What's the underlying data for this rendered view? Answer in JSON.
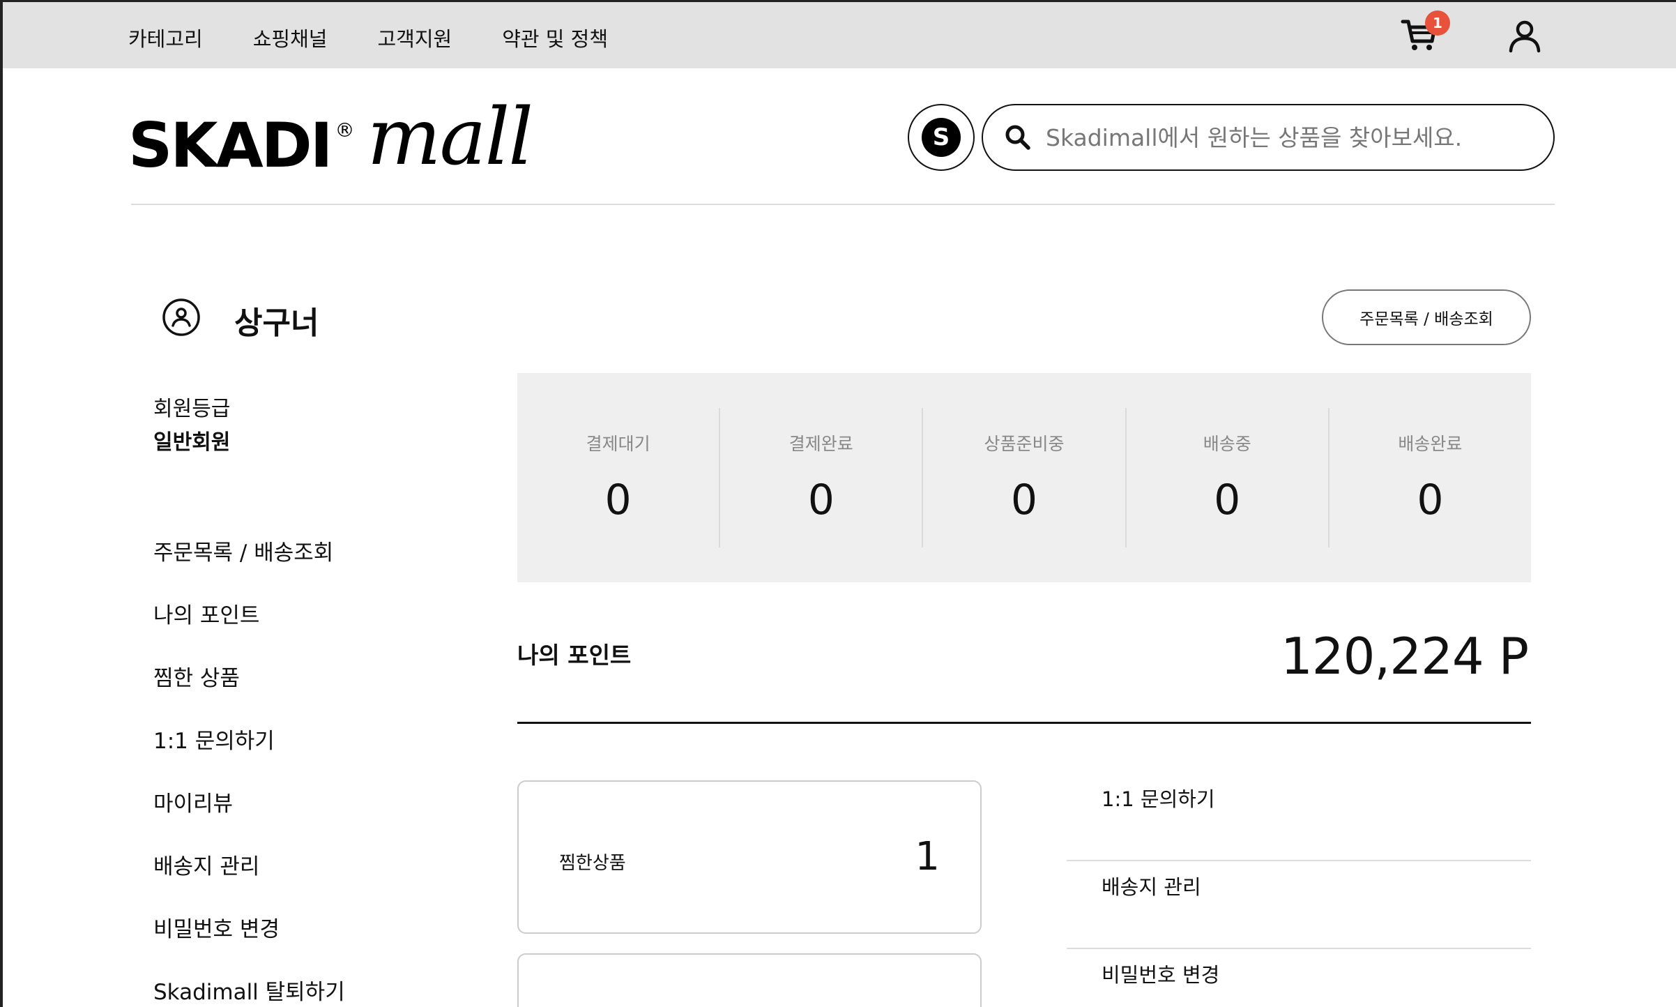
{
  "topnav": {
    "items": [
      "카테고리",
      "쇼핑채널",
      "고객지원",
      "약관 및 정책"
    ],
    "cart_count": "1"
  },
  "header": {
    "logo_brand": "SKADI",
    "logo_reg": "®",
    "logo_script": "mall",
    "s_badge": "S",
    "search_placeholder": "Skadimall에서 원하는 상품을 찾아보세요."
  },
  "profile": {
    "name": "상구너",
    "order_button": "주문목록 / 배송조회",
    "grade_label": "회원등급",
    "grade_value": "일반회원"
  },
  "sidebar": {
    "items": [
      "주문목록 / 배송조회",
      "나의 포인트",
      "찜한 상품",
      "1:1 문의하기",
      "마이리뷰",
      "배송지 관리",
      "비밀번호 변경",
      "Skadimall 탈퇴하기"
    ]
  },
  "order_status": [
    {
      "label": "결제대기",
      "count": "0"
    },
    {
      "label": "결제완료",
      "count": "0"
    },
    {
      "label": "상품준비중",
      "count": "0"
    },
    {
      "label": "배송중",
      "count": "0"
    },
    {
      "label": "배송완료",
      "count": "0"
    }
  ],
  "points": {
    "label": "나의 포인트",
    "value": "120,224 P"
  },
  "wishlist_card": {
    "label": "찜한상품",
    "count": "1"
  },
  "quick_links": [
    "1:1 문의하기",
    "배송지 관리",
    "비밀번호 변경"
  ],
  "colors": {
    "topbar_bg": "#e2e2e2",
    "badge": "#e8513a",
    "status_panel_bg": "#efefef"
  }
}
